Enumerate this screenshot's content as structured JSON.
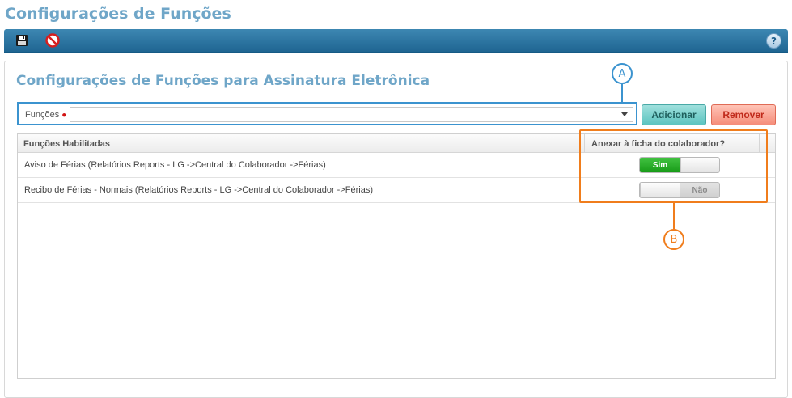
{
  "page": {
    "title": "Configurações de Funções"
  },
  "toolbar": {
    "save_icon": "save-floppy-icon",
    "cancel_icon": "cancel-no-entry-icon",
    "help_label": "?"
  },
  "section": {
    "title": "Configurações de Funções para Assinatura Eletrônica"
  },
  "form": {
    "field_label": "Funções",
    "select_value": "",
    "add_label": "Adicionar",
    "remove_label": "Remover"
  },
  "grid": {
    "columns": [
      "Funções Habilitadas",
      "Anexar à ficha do colaborador?"
    ],
    "rows": [
      {
        "name": "Aviso de Férias (Relatórios Reports - LG ->Central do Colaborador ->Férias)",
        "toggle_label": "Sim",
        "toggle_on": true
      },
      {
        "name": "Recibo de Férias - Normais (Relatórios Reports - LG ->Central do Colaborador ->Férias)",
        "toggle_label": "Não",
        "toggle_on": false
      }
    ]
  },
  "annotations": {
    "a": "A",
    "b": "B"
  },
  "colors": {
    "accent_blue": "#3b93cf",
    "annotation_orange": "#f07d1c",
    "toggle_on": "#189b18"
  }
}
